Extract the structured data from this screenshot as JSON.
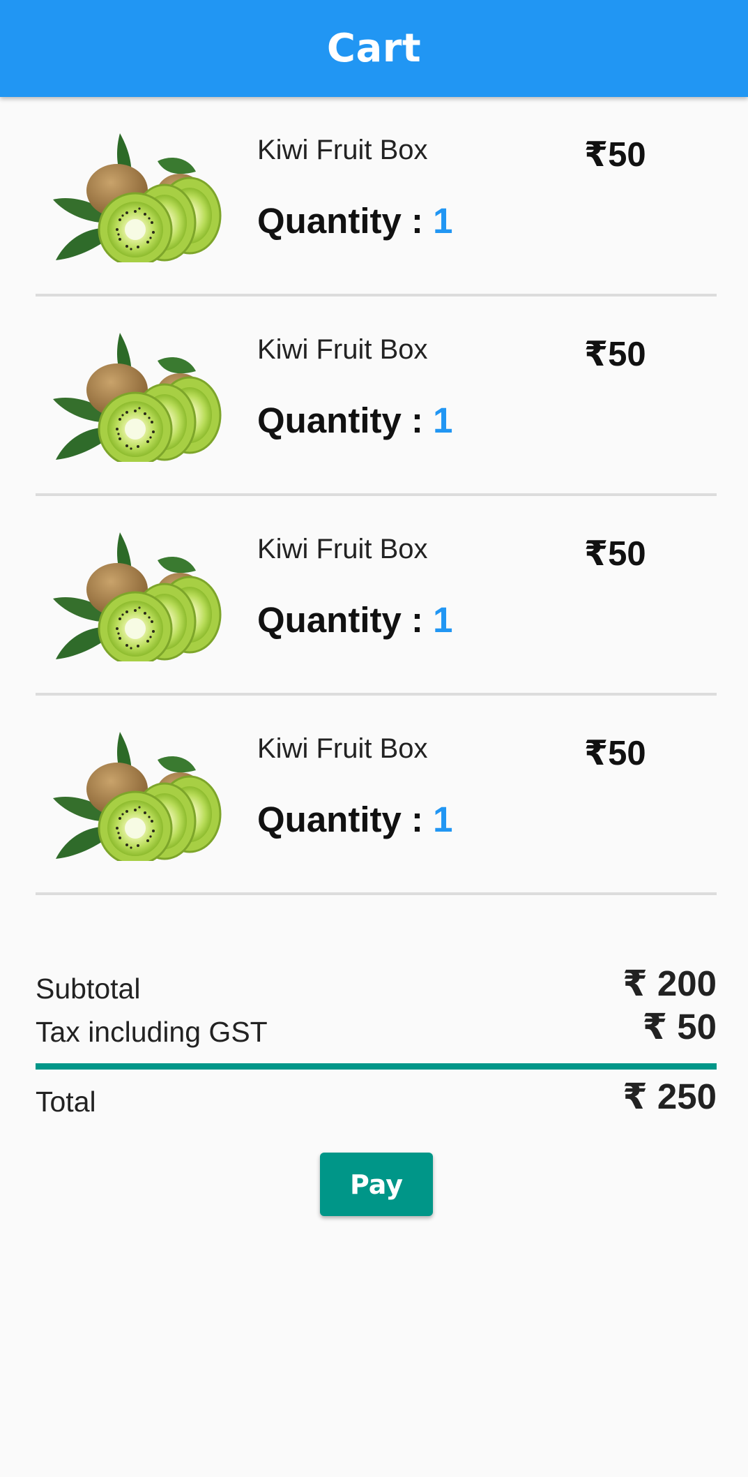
{
  "app_bar": {
    "title": "Cart"
  },
  "colors": {
    "app_bar": "#2196f3",
    "accent_blue": "#2196f3",
    "teal": "#009688",
    "background": "#fafafa",
    "divider": "#dcdcdc"
  },
  "cart": {
    "items": [
      {
        "image_icon": "kiwi-fruit-image",
        "name": "Kiwi Fruit Box",
        "price": "₹50",
        "quantity_label": "Quantity : ",
        "quantity": "1"
      },
      {
        "image_icon": "kiwi-fruit-image",
        "name": "Kiwi Fruit Box",
        "price": "₹50",
        "quantity_label": "Quantity : ",
        "quantity": "1"
      },
      {
        "image_icon": "kiwi-fruit-image",
        "name": "Kiwi Fruit Box",
        "price": "₹50",
        "quantity_label": "Quantity : ",
        "quantity": "1"
      },
      {
        "image_icon": "kiwi-fruit-image",
        "name": "Kiwi Fruit Box",
        "price": "₹50",
        "quantity_label": "Quantity : ",
        "quantity": "1"
      }
    ]
  },
  "summary": {
    "subtotal_label": "Subtotal",
    "subtotal_value": "₹ 200",
    "tax_label": "Tax including GST",
    "tax_value": "₹ 50",
    "total_label": "Total",
    "total_value": "₹ 250"
  },
  "pay_button": {
    "label": "Pay"
  }
}
